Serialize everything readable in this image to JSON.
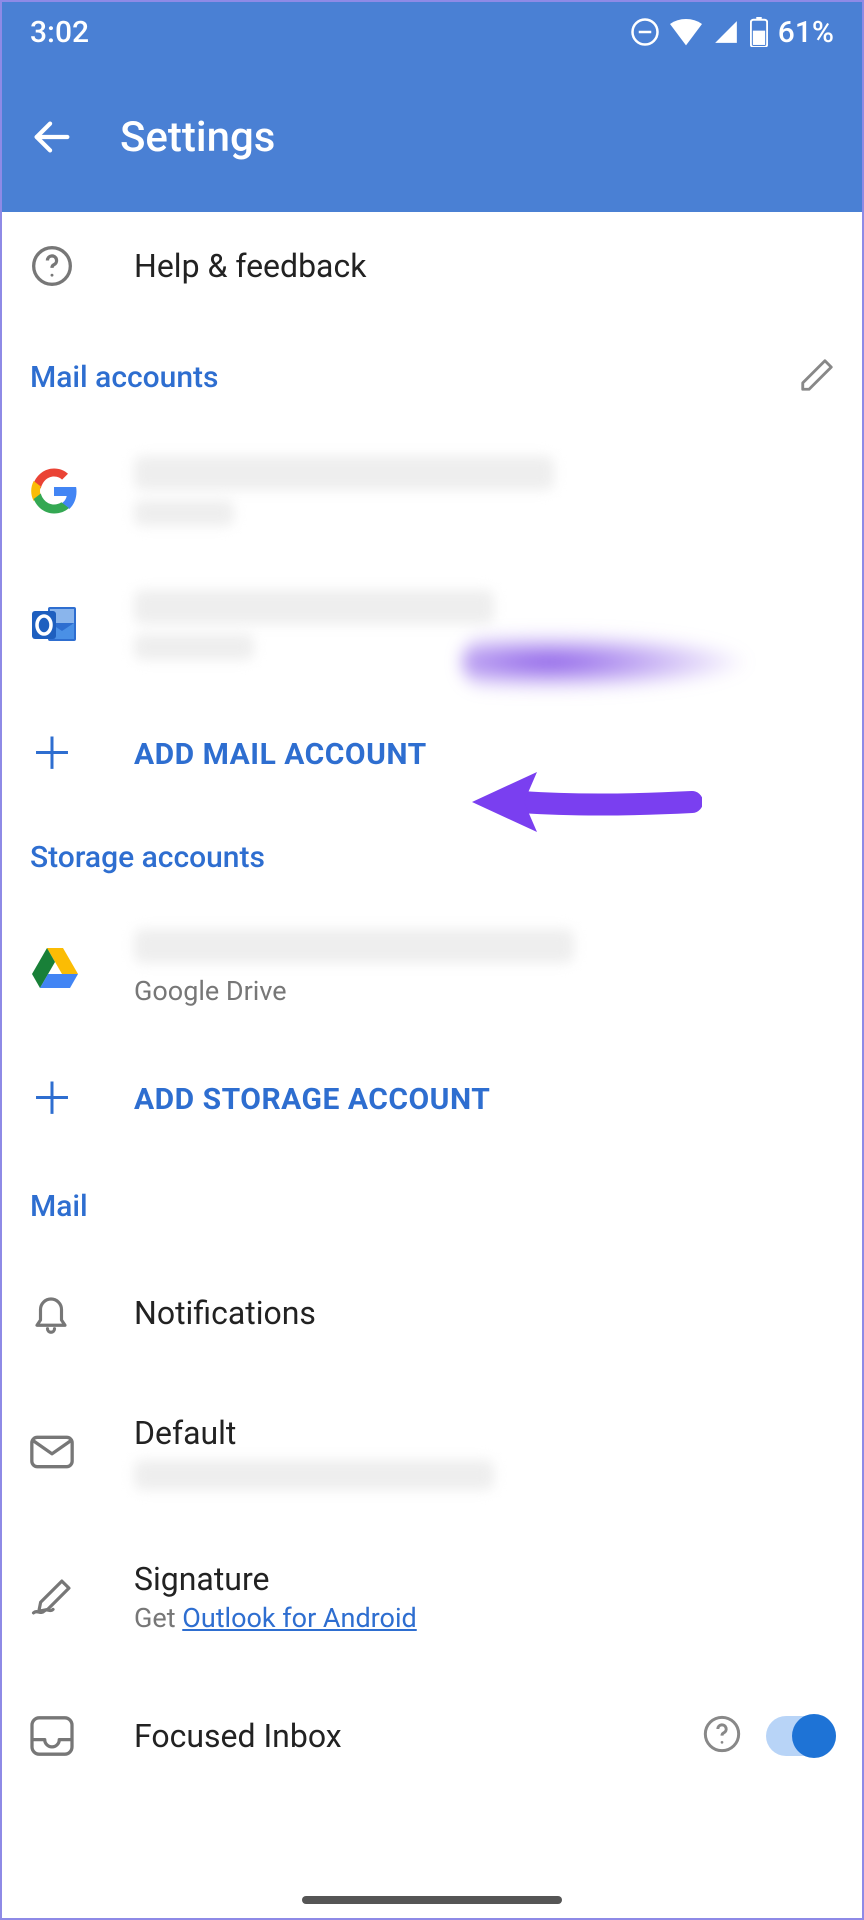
{
  "status": {
    "time": "3:02",
    "battery": "61%"
  },
  "header": {
    "title": "Settings"
  },
  "help": {
    "label": "Help & feedback"
  },
  "sections": {
    "mail_accounts": {
      "heading": "Mail accounts"
    },
    "storage_accounts": {
      "heading": "Storage accounts"
    },
    "mail": {
      "heading": "Mail"
    }
  },
  "add_mail": {
    "label": "ADD MAIL ACCOUNT"
  },
  "add_storage": {
    "label": "ADD STORAGE ACCOUNT"
  },
  "storage_item": {
    "subtitle": "Google Drive"
  },
  "mail_settings": {
    "notifications": {
      "title": "Notifications"
    },
    "default": {
      "title": "Default"
    },
    "signature": {
      "title": "Signature",
      "prefix": "Get ",
      "link": "Outlook for Android"
    },
    "focused": {
      "title": "Focused Inbox"
    }
  }
}
